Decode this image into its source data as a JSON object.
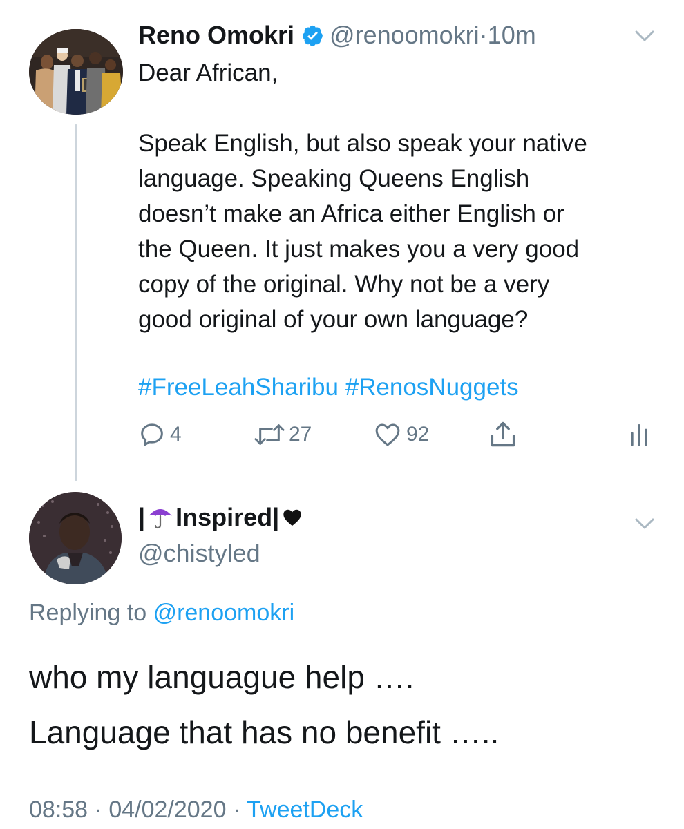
{
  "parent_tweet": {
    "display_name": "Reno Omokri",
    "handle": "@renoomokri",
    "separator": "·",
    "time_ago": "10m",
    "text_lines": [
      "Dear African,",
      "",
      "Speak English, but also speak your native",
      "language. Speaking Queens English",
      "doesn’t make an Africa either English or",
      "the Queen. It just makes you a very good",
      "copy of the original. Why not be a very",
      "good original of your own language?"
    ],
    "hashtags": [
      "#FreeLeahSharibu",
      "#RenosNuggets"
    ],
    "actions": {
      "reply_count": "4",
      "retweet_count": "27",
      "like_count": "92"
    }
  },
  "reply_tweet": {
    "display_name_prefix": "|",
    "display_name_text": "Inspired|",
    "handle": "@chistyled",
    "replying_label": "Replying to",
    "replying_handle": "@renoomokri",
    "text_lines": [
      "who my languague help ….",
      "Language that has no benefit ….."
    ],
    "time": "08:58",
    "date": "04/02/2020",
    "source": "TweetDeck",
    "separator": "·"
  },
  "icons": {
    "verified_badge": "verified-badge-icon",
    "chevron": "chevron-down-icon",
    "reply": "reply-icon",
    "retweet": "retweet-icon",
    "like": "heart-icon",
    "share": "share-icon",
    "analytics": "analytics-icon",
    "umbrella": "umbrella-emoji-icon",
    "black_heart": "black-heart-emoji-icon"
  },
  "colors": {
    "link_blue": "#1da1f2",
    "muted_gray": "#657786",
    "text_black": "#14171a",
    "thread_line": "#cdd5dc",
    "umbrella_purple": "#8b3fd1"
  }
}
